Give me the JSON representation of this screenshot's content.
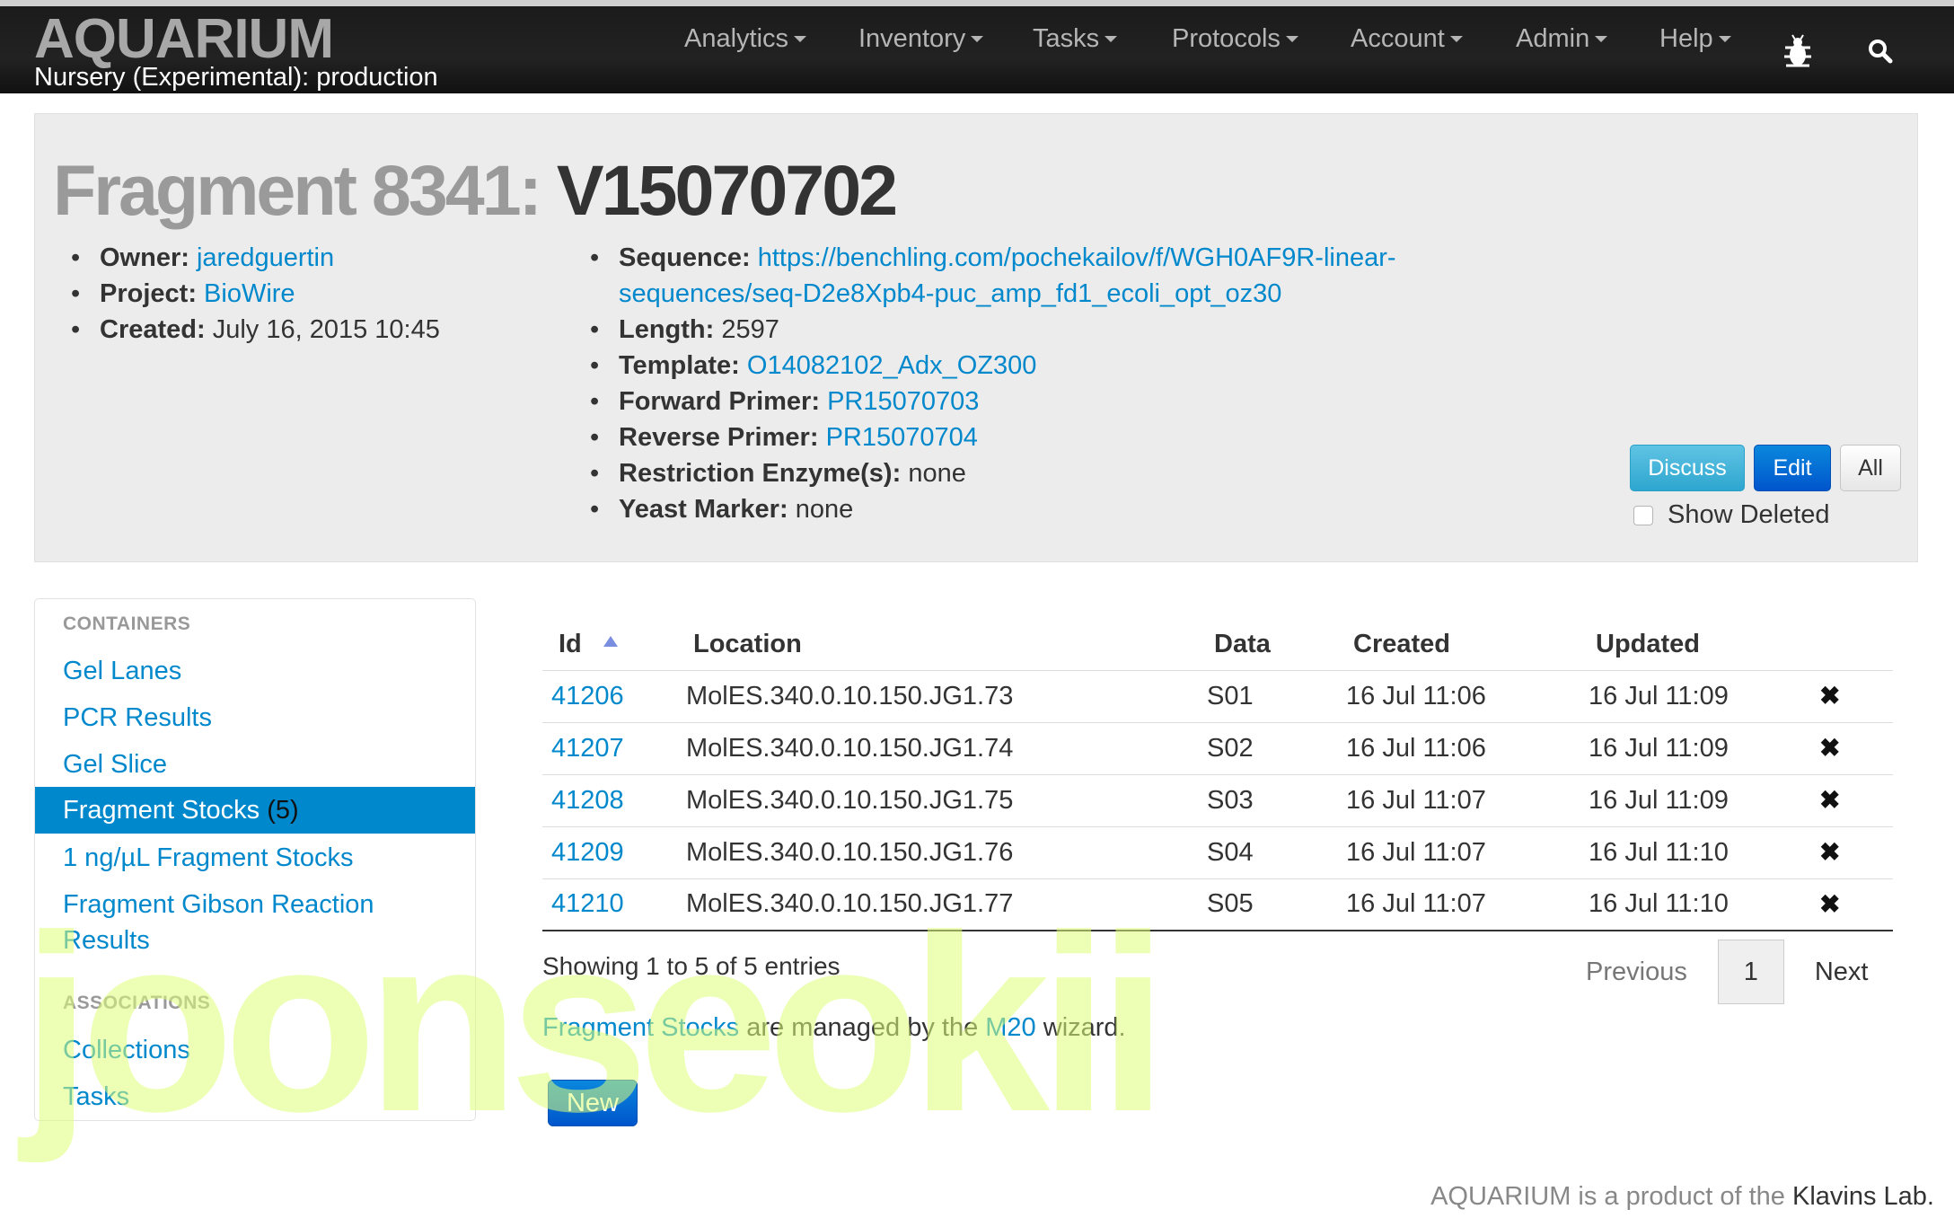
{
  "navbar": {
    "brand_title": "AQUARIUM",
    "brand_subtitle": "Nursery (Experimental): production",
    "menu": [
      "Analytics",
      "Inventory",
      "Tasks",
      "Protocols",
      "Account",
      "Admin",
      "Help"
    ],
    "bug_icon": "bug-icon",
    "search_icon": "search-icon"
  },
  "header": {
    "title_prefix": "Fragment 8341:",
    "title_name": "V15070702",
    "owner_label": "Owner:",
    "owner_value": "jaredguertin",
    "project_label": "Project:",
    "project_value": "BioWire",
    "created_label": "Created:",
    "created_value": "July 16, 2015 10:45",
    "sequence_label": "Sequence",
    "sequence_line1": "https://benchling.com/pochekailov/f/WGH0AF9R-linear-",
    "sequence_line2": "sequences/seq-D2e8Xpb4-puc_amp_fd1_ecoli_opt_oz30",
    "length_label": "Length",
    "length_value": "2597",
    "template_label": "Template",
    "template_value": "O14082102_Adx_OZ300",
    "fwd_label": "Forward Primer",
    "fwd_value": "PR15070703",
    "rev_label": "Reverse Primer",
    "rev_value": "PR15070704",
    "enzyme_label": "Restriction Enzyme(s)",
    "enzyme_value": "none",
    "yeast_label": "Yeast Marker",
    "yeast_value": "none",
    "discuss_label": "Discuss",
    "edit_label": "Edit",
    "all_label": "All",
    "show_deleted_label": "Show Deleted"
  },
  "sidebar": {
    "containers_header": "CONTAINERS",
    "items": [
      {
        "label": "Gel Lanes"
      },
      {
        "label": "PCR Results"
      },
      {
        "label": "Gel Slice"
      },
      {
        "label": "Fragment Stocks",
        "count": "(5)"
      },
      {
        "label": "1 ng/µL Fragment Stocks"
      },
      {
        "label": "Fragment Gibson Reaction"
      },
      {
        "label": "Results"
      }
    ],
    "associations_header": "ASSOCIATIONS",
    "associations": [
      {
        "label": "Collections"
      },
      {
        "label": "Tasks"
      }
    ]
  },
  "table": {
    "columns": [
      "Id",
      "Location",
      "Data",
      "Created",
      "Updated"
    ],
    "rows": [
      {
        "id": "41206",
        "location": "MolES.340.0.10.150.JG1.73",
        "data": "S01",
        "created": "16 Jul 11:06",
        "updated": "16 Jul 11:09"
      },
      {
        "id": "41207",
        "location": "MolES.340.0.10.150.JG1.74",
        "data": "S02",
        "created": "16 Jul 11:06",
        "updated": "16 Jul 11:09"
      },
      {
        "id": "41208",
        "location": "MolES.340.0.10.150.JG1.75",
        "data": "S03",
        "created": "16 Jul 11:07",
        "updated": "16 Jul 11:09"
      },
      {
        "id": "41209",
        "location": "MolES.340.0.10.150.JG1.76",
        "data": "S04",
        "created": "16 Jul 11:07",
        "updated": "16 Jul 11:10"
      },
      {
        "id": "41210",
        "location": "MolES.340.0.10.150.JG1.77",
        "data": "S05",
        "created": "16 Jul 11:07",
        "updated": "16 Jul 11:10"
      }
    ],
    "delete_glyph": "✖",
    "showing": "Showing 1 to 5 of 5 entries",
    "prev_label": "Previous",
    "page": "1",
    "next_label": "Next"
  },
  "managed": {
    "link1": "Fragment Stocks",
    "text1": " are managed by the ",
    "link2": "M20",
    "text2": " wizard."
  },
  "new_button": "New",
  "footer": {
    "text": "AQUARIUM is a product of the ",
    "lab": "Klavins Lab."
  },
  "watermark": "joonseokii"
}
